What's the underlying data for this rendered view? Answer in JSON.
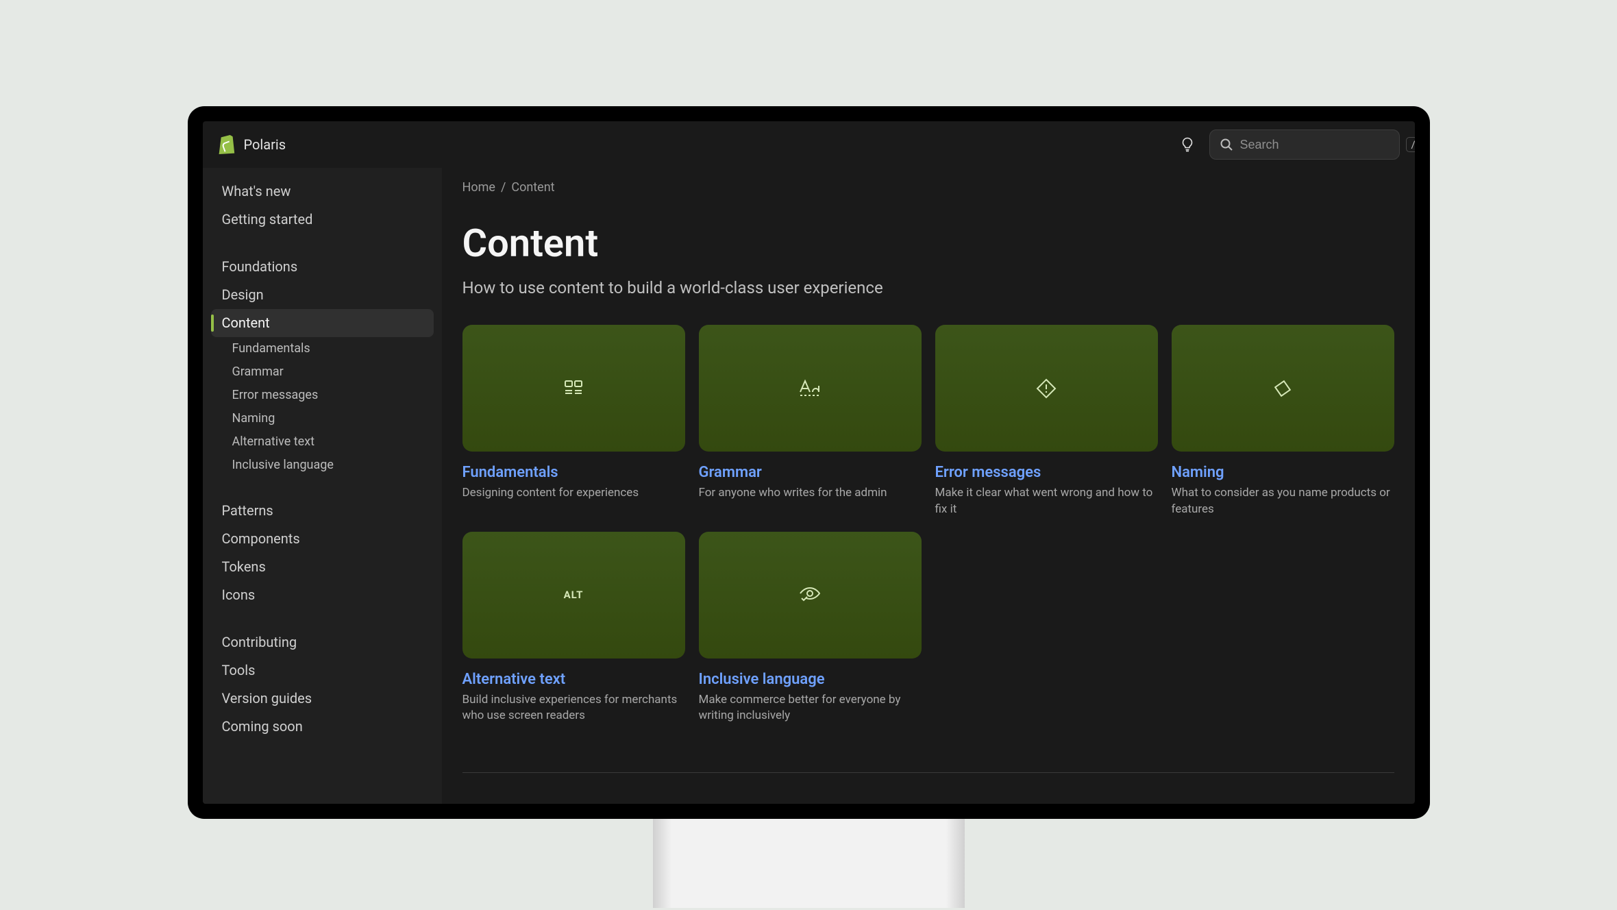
{
  "brand": {
    "name": "Polaris"
  },
  "search": {
    "placeholder": "Search",
    "shortcut": "/"
  },
  "sidebar": {
    "groups": [
      {
        "items": [
          {
            "label": "What's new"
          },
          {
            "label": "Getting started"
          }
        ]
      },
      {
        "items": [
          {
            "label": "Foundations"
          },
          {
            "label": "Design"
          },
          {
            "label": "Content",
            "active": true,
            "children": [
              {
                "label": "Fundamentals"
              },
              {
                "label": "Grammar"
              },
              {
                "label": "Error messages"
              },
              {
                "label": "Naming"
              },
              {
                "label": "Alternative text"
              },
              {
                "label": "Inclusive language"
              }
            ]
          }
        ]
      },
      {
        "items": [
          {
            "label": "Patterns"
          },
          {
            "label": "Components"
          },
          {
            "label": "Tokens"
          },
          {
            "label": "Icons"
          }
        ]
      },
      {
        "items": [
          {
            "label": "Contributing"
          },
          {
            "label": "Tools"
          },
          {
            "label": "Version guides"
          },
          {
            "label": "Coming soon"
          }
        ]
      }
    ]
  },
  "breadcrumb": {
    "home": "Home",
    "sep": "/",
    "current": "Content"
  },
  "page": {
    "title": "Content",
    "subtitle": "How to use content to build a world-class user experience"
  },
  "cards": [
    {
      "icon": "grid",
      "title": "Fundamentals",
      "desc": "Designing content for experiences"
    },
    {
      "icon": "aa",
      "title": "Grammar",
      "desc": "For anyone who writes for the admin"
    },
    {
      "icon": "diamond",
      "title": "Error messages",
      "desc": "Make it clear what went wrong and how to fix it"
    },
    {
      "icon": "tag",
      "title": "Naming",
      "desc": "What to consider as you name products or features"
    },
    {
      "icon": "alt",
      "title": "Alternative text",
      "desc": "Build inclusive experiences for merchants who use screen readers"
    },
    {
      "icon": "eye",
      "title": "Inclusive language",
      "desc": "Make commerce better for everyone by writing inclusively"
    }
  ]
}
